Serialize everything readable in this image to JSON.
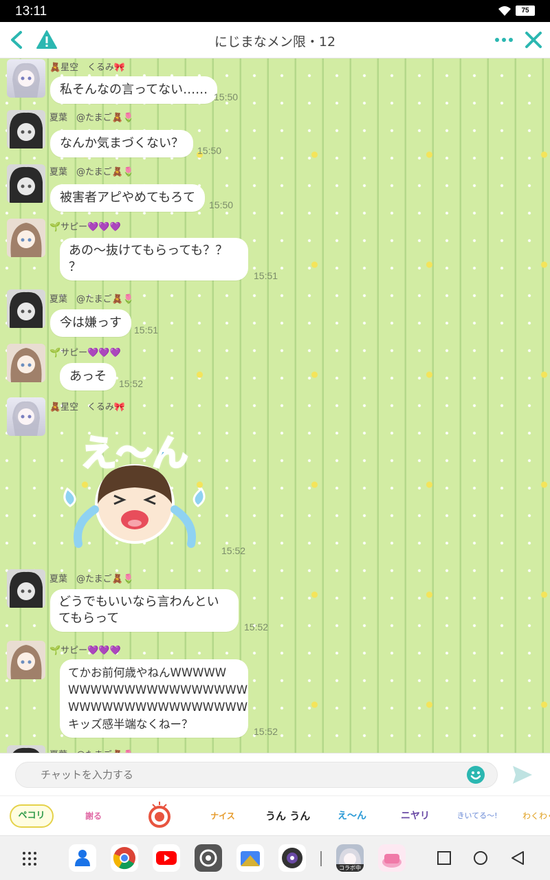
{
  "status": {
    "time": "13:11",
    "battery": "75"
  },
  "header": {
    "title": "にじまなメン限・12"
  },
  "messages": [
    {
      "sender": "🧸星空　くるみ🎀",
      "text": "私そんなの言ってない……",
      "time": "15:50"
    },
    {
      "sender": "夏葉　@たまご🧸🌷",
      "text": "なんか気まづくない？",
      "time": "15:50"
    },
    {
      "sender": "夏葉　@たまご🧸🌷",
      "text": "被害者アピやめてもろて",
      "time": "15:50"
    },
    {
      "sender": "🌱サピー💜💜💜",
      "text_lines": [
        "あの〜抜けてもらっても？？",
        "？"
      ],
      "time": "15:51"
    },
    {
      "sender": "夏葉　@たまご🧸🌷",
      "text": "今は嫌っす",
      "time": "15:51"
    },
    {
      "sender": "🌱サピー💜💜💜",
      "text": "あっそ",
      "time": "15:52"
    },
    {
      "sender": "🧸星空　くるみ🎀",
      "sticker_text": "え〜ん",
      "time": "15:52"
    },
    {
      "sender": "夏葉　@たまご🧸🌷",
      "text_lines": [
        "どうでもいいなら言わんとい",
        "てもらって"
      ],
      "time": "15:52"
    },
    {
      "sender": "🌱サピー💜💜💜",
      "text_lines": [
        "てかお前何歳やねんWWWWW",
        "WWWWWWWWWWWWWWWW",
        "WWWWWWWWWWWWWWWW",
        "キッズ感半端なくねー？"
      ],
      "time": "15:52"
    },
    {
      "sender": "夏葉　@たまご🧸🌷"
    }
  ],
  "input": {
    "placeholder": "チャットを入力する"
  },
  "stickers": [
    "ペコリ",
    "謝る",
    "",
    "ナイス",
    "うん うん",
    "え〜ん",
    "ニヤリ",
    "きいてる〜!",
    "わくわく"
  ],
  "dock": {
    "collab_label": "コラボ中"
  },
  "colors": {
    "accent": "#2bb7b1",
    "background": "#d2eca3",
    "bubble": "#ffffff"
  }
}
